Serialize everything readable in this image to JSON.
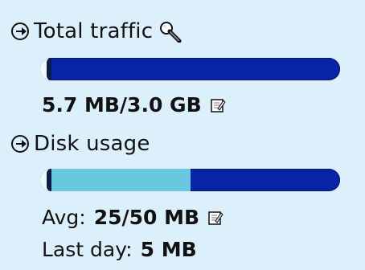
{
  "sections": [
    {
      "title": "Total traffic",
      "value": "5.7 MB/3.0 GB",
      "progress_fraction": 0.019,
      "icon": "search-icon"
    },
    {
      "title": "Disk usage",
      "avg_label": "Avg:",
      "avg_value": "25/50 MB",
      "last_day_label": "Last day:",
      "last_day_value": "5 MB",
      "progress_fraction": 0.5,
      "icon": "edit-icon"
    }
  ],
  "colors": {
    "background": "#dcf0fb",
    "bar_dark": "#0923a7",
    "bar_light": "#69c8dd"
  }
}
